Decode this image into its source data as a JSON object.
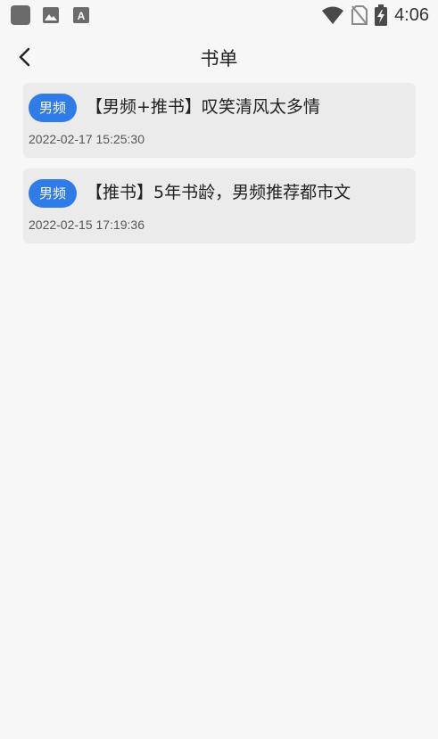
{
  "status_bar": {
    "time": "4:06",
    "icons": [
      "app-square-icon",
      "image-icon",
      "font-icon",
      "wifi-icon",
      "no-sim-icon",
      "battery-charging-icon"
    ]
  },
  "header": {
    "title": "书单",
    "back_icon": "chevron-left-icon"
  },
  "booklist": {
    "items": [
      {
        "tag": "男频",
        "title": "【男频+推书】叹笑清风太多情",
        "time": "2022-02-17 15:25:30"
      },
      {
        "tag": "男频",
        "title": "【推书】5年书龄，男频推荐都市文",
        "time": "2022-02-15 17:19:36"
      }
    ]
  },
  "colors": {
    "background": "#f7f7f7",
    "card": "#ebebeb",
    "tag": "#2f7be8"
  }
}
